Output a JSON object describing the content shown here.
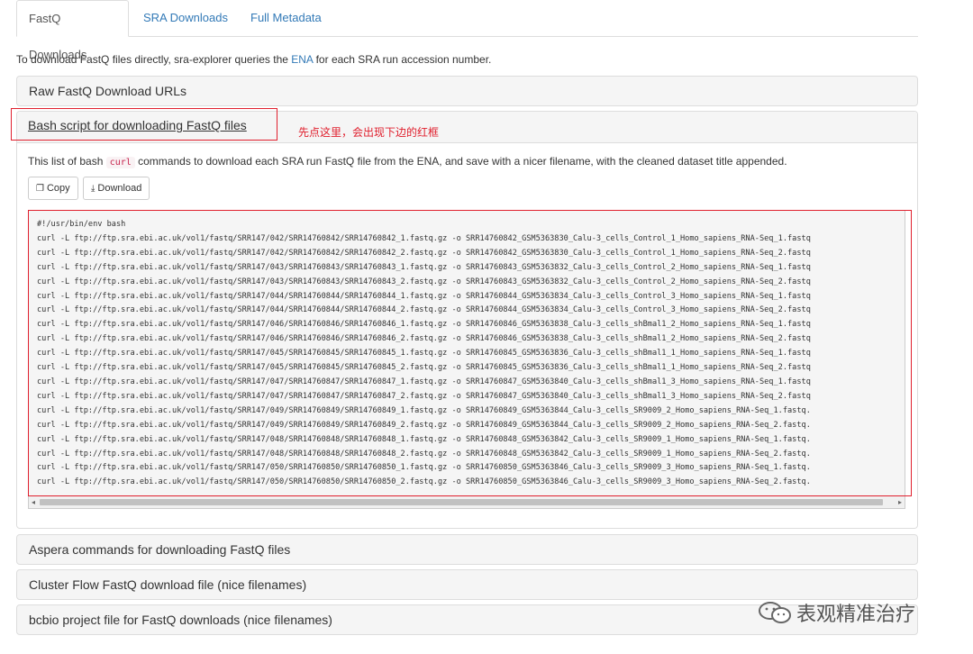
{
  "tabs": [
    {
      "label": "FastQ Downloads",
      "active": true
    },
    {
      "label": "SRA Downloads",
      "active": false
    },
    {
      "label": "Full Metadata",
      "active": false
    }
  ],
  "intro": {
    "before": "To download FastQ files directly, sra-explorer queries the ",
    "link": "ENA",
    "after": " for each SRA run accession number."
  },
  "panels": {
    "raw": "Raw FastQ Download URLs",
    "bash": "Bash script for downloading FastQ files",
    "aspera": "Aspera commands for downloading FastQ files",
    "clusterflow": "Cluster Flow FastQ download file (nice filenames)",
    "bcbio": "bcbio project file for FastQ downloads (nice filenames)"
  },
  "annotation": "先点这里，会出现下边的红框",
  "bash_panel": {
    "desc_before": "This list of bash ",
    "desc_code": "curl",
    "desc_after": " commands to download each SRA run FastQ file from the ENA, and save with a nicer filename, with the cleaned dataset title appended.",
    "copy_label": "Copy",
    "download_label": "Download",
    "script_lines": [
      "#!/usr/bin/env bash",
      "curl -L ftp://ftp.sra.ebi.ac.uk/vol1/fastq/SRR147/042/SRR14760842/SRR14760842_1.fastq.gz -o SRR14760842_GSM5363830_Calu-3_cells_Control_1_Homo_sapiens_RNA-Seq_1.fastq",
      "curl -L ftp://ftp.sra.ebi.ac.uk/vol1/fastq/SRR147/042/SRR14760842/SRR14760842_2.fastq.gz -o SRR14760842_GSM5363830_Calu-3_cells_Control_1_Homo_sapiens_RNA-Seq_2.fastq",
      "curl -L ftp://ftp.sra.ebi.ac.uk/vol1/fastq/SRR147/043/SRR14760843/SRR14760843_1.fastq.gz -o SRR14760843_GSM5363832_Calu-3_cells_Control_2_Homo_sapiens_RNA-Seq_1.fastq",
      "curl -L ftp://ftp.sra.ebi.ac.uk/vol1/fastq/SRR147/043/SRR14760843/SRR14760843_2.fastq.gz -o SRR14760843_GSM5363832_Calu-3_cells_Control_2_Homo_sapiens_RNA-Seq_2.fastq",
      "curl -L ftp://ftp.sra.ebi.ac.uk/vol1/fastq/SRR147/044/SRR14760844/SRR14760844_1.fastq.gz -o SRR14760844_GSM5363834_Calu-3_cells_Control_3_Homo_sapiens_RNA-Seq_1.fastq",
      "curl -L ftp://ftp.sra.ebi.ac.uk/vol1/fastq/SRR147/044/SRR14760844/SRR14760844_2.fastq.gz -o SRR14760844_GSM5363834_Calu-3_cells_Control_3_Homo_sapiens_RNA-Seq_2.fastq",
      "curl -L ftp://ftp.sra.ebi.ac.uk/vol1/fastq/SRR147/046/SRR14760846/SRR14760846_1.fastq.gz -o SRR14760846_GSM5363838_Calu-3_cells_shBmal1_2_Homo_sapiens_RNA-Seq_1.fastq",
      "curl -L ftp://ftp.sra.ebi.ac.uk/vol1/fastq/SRR147/046/SRR14760846/SRR14760846_2.fastq.gz -o SRR14760846_GSM5363838_Calu-3_cells_shBmal1_2_Homo_sapiens_RNA-Seq_2.fastq",
      "curl -L ftp://ftp.sra.ebi.ac.uk/vol1/fastq/SRR147/045/SRR14760845/SRR14760845_1.fastq.gz -o SRR14760845_GSM5363836_Calu-3_cells_shBmal1_1_Homo_sapiens_RNA-Seq_1.fastq",
      "curl -L ftp://ftp.sra.ebi.ac.uk/vol1/fastq/SRR147/045/SRR14760845/SRR14760845_2.fastq.gz -o SRR14760845_GSM5363836_Calu-3_cells_shBmal1_1_Homo_sapiens_RNA-Seq_2.fastq",
      "curl -L ftp://ftp.sra.ebi.ac.uk/vol1/fastq/SRR147/047/SRR14760847/SRR14760847_1.fastq.gz -o SRR14760847_GSM5363840_Calu-3_cells_shBmal1_3_Homo_sapiens_RNA-Seq_1.fastq",
      "curl -L ftp://ftp.sra.ebi.ac.uk/vol1/fastq/SRR147/047/SRR14760847/SRR14760847_2.fastq.gz -o SRR14760847_GSM5363840_Calu-3_cells_shBmal1_3_Homo_sapiens_RNA-Seq_2.fastq",
      "curl -L ftp://ftp.sra.ebi.ac.uk/vol1/fastq/SRR147/049/SRR14760849/SRR14760849_1.fastq.gz -o SRR14760849_GSM5363844_Calu-3_cells_SR9009_2_Homo_sapiens_RNA-Seq_1.fastq.",
      "curl -L ftp://ftp.sra.ebi.ac.uk/vol1/fastq/SRR147/049/SRR14760849/SRR14760849_2.fastq.gz -o SRR14760849_GSM5363844_Calu-3_cells_SR9009_2_Homo_sapiens_RNA-Seq_2.fastq.",
      "curl -L ftp://ftp.sra.ebi.ac.uk/vol1/fastq/SRR147/048/SRR14760848/SRR14760848_1.fastq.gz -o SRR14760848_GSM5363842_Calu-3_cells_SR9009_1_Homo_sapiens_RNA-Seq_1.fastq.",
      "curl -L ftp://ftp.sra.ebi.ac.uk/vol1/fastq/SRR147/048/SRR14760848/SRR14760848_2.fastq.gz -o SRR14760848_GSM5363842_Calu-3_cells_SR9009_1_Homo_sapiens_RNA-Seq_2.fastq.",
      "curl -L ftp://ftp.sra.ebi.ac.uk/vol1/fastq/SRR147/050/SRR14760850/SRR14760850_1.fastq.gz -o SRR14760850_GSM5363846_Calu-3_cells_SR9009_3_Homo_sapiens_RNA-Seq_1.fastq.",
      "curl -L ftp://ftp.sra.ebi.ac.uk/vol1/fastq/SRR147/050/SRR14760850/SRR14760850_2.fastq.gz -o SRR14760850_GSM5363846_Calu-3_cells_SR9009_3_Homo_sapiens_RNA-Seq_2.fastq."
    ]
  },
  "watermark": "表观精准治疗",
  "colors": {
    "link": "#337ab7",
    "annotation_red": "#e0202e",
    "panel_bg": "#f5f5f5",
    "border": "#dddddd"
  }
}
